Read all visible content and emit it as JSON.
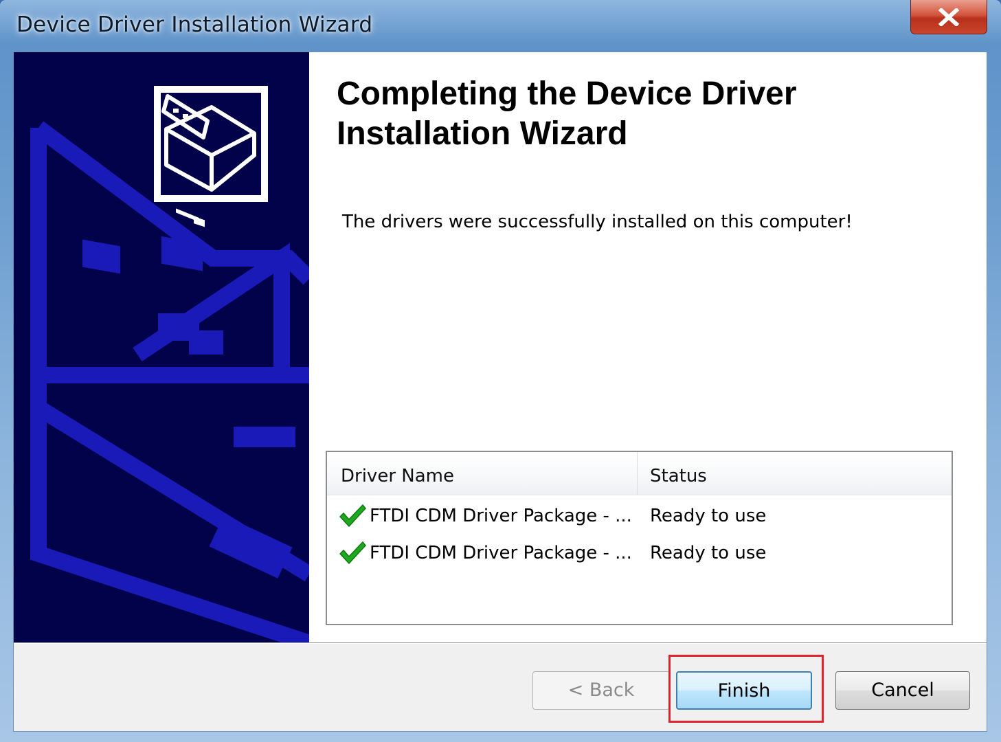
{
  "window": {
    "title": "Device Driver Installation Wizard"
  },
  "icons": {
    "close": "close-icon",
    "hardware": "hardware-device-icon",
    "check": "green-checkmark-icon"
  },
  "wizard": {
    "heading": "Completing the Device Driver Installation Wizard",
    "message": "The drivers were successfully installed on this computer!"
  },
  "driver_table": {
    "columns": [
      "Driver Name",
      "Status"
    ],
    "rows": [
      {
        "name": "FTDI CDM Driver Package - ...",
        "status": "Ready to use"
      },
      {
        "name": "FTDI CDM Driver Package - ...",
        "status": "Ready to use"
      }
    ]
  },
  "buttons": {
    "back": "< Back",
    "finish": "Finish",
    "cancel": "Cancel"
  },
  "colors": {
    "banner": "#01024a",
    "highlight": "#e0242c",
    "check": "#1fa81f"
  }
}
